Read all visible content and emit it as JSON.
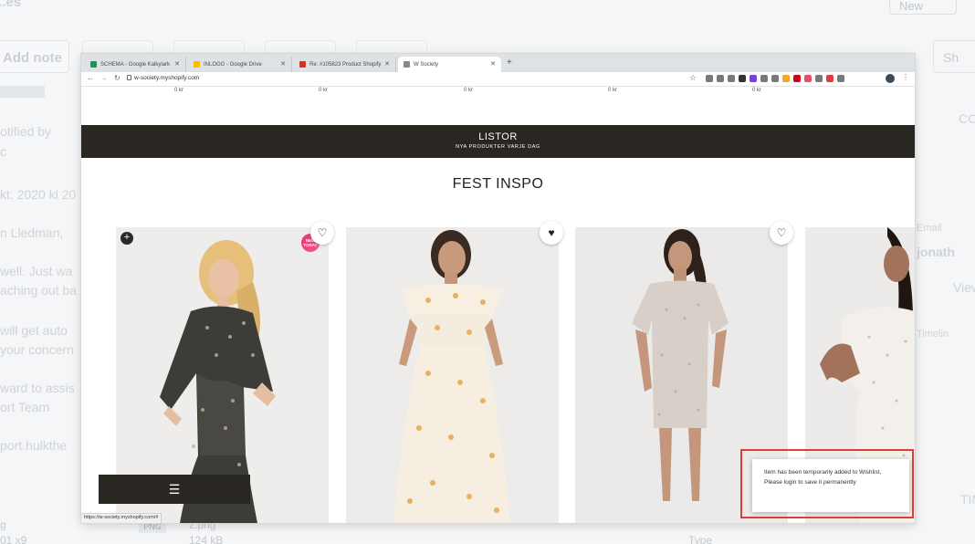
{
  "background_app": {
    "title": "...es",
    "new_button": "New",
    "add_note": "Add note",
    "show_button": "Sh",
    "left_lines": [
      "otified by",
      "c",
      "kt. 2020 kl 20",
      "n Lledman,",
      "well. Just wa",
      "aching out ba",
      "will get auto",
      "your concern",
      "ward to assis",
      "ort Team",
      "port.hulkthe"
    ],
    "right_lines": [
      "CO",
      "Email",
      "jonath",
      "View",
      "Timelin",
      "TIM"
    ],
    "bottom": {
      "left": "g",
      "left2": "01 x9",
      "type_badge": "PNG",
      "file_name": "z.png",
      "file_size": "124 kB",
      "type_label": "Type"
    }
  },
  "browser": {
    "tabs": [
      {
        "label": "SCHEMA - Google Kalkylark",
        "favicon_color": "#0f9d58"
      },
      {
        "label": "INLOGG - Google Drive",
        "favicon_color": "#fbbc04"
      },
      {
        "label": "Re: #105823 Product Shopify",
        "favicon_color": "#d93025"
      },
      {
        "label": "W Society",
        "favicon_color": "#888888"
      }
    ],
    "new_tab": "+",
    "url": "w-society.myshopify.com",
    "extension_colors": [
      "#7a7a7a",
      "#7a7a7a",
      "#7a7a7a",
      "#333333",
      "#7b3fe4",
      "#7a7a7a",
      "#7a7a7a",
      "#f5a623",
      "#d0021b",
      "#e94b6a",
      "#7a7a7a",
      "#e23b3b",
      "#7a7a7a"
    ],
    "status_url": "https://w-society.myshopify.com/#"
  },
  "store": {
    "prices": [
      "0 kr",
      "0 kr",
      "0 kr",
      "0 kr",
      "0 kr"
    ],
    "banner_title": "LISTOR",
    "banner_subtitle": "NYA PRODUKTER VARJE DAG",
    "section_title": "FEST INSPO",
    "new_badge": "NEW TODAY",
    "menu_icon": "☰",
    "toast": "Item has been temporarily added to Wishlist, Please login to save it permanently"
  }
}
